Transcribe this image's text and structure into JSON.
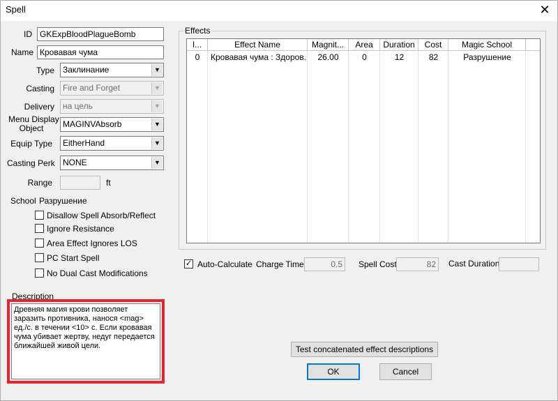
{
  "window": {
    "title": "Spell",
    "close_glyph": "✕"
  },
  "form": {
    "id_label": "ID",
    "id_value": "GKExpBloodPlagueBomb",
    "name_label": "Name",
    "name_value": "Кровавая чума",
    "type_label": "Type",
    "type_value": "Заклинание",
    "casting_label": "Casting",
    "casting_value": "Fire and Forget",
    "delivery_label": "Delivery",
    "delivery_value": "на цель",
    "menu_display_label_1": "Menu Display",
    "menu_display_label_2": "Object",
    "menu_display_value": "MAGINVAbsorb",
    "equip_type_label": "Equip Type",
    "equip_type_value": "EitherHand",
    "casting_perk_label": "Casting Perk",
    "casting_perk_value": "NONE",
    "range_label": "Range",
    "range_value": "",
    "range_unit": "ft",
    "school_label": "School",
    "school_value": "Разрушение"
  },
  "checkboxes": [
    {
      "label": "Disallow Spell Absorb/Reflect",
      "checked": false
    },
    {
      "label": "Ignore Resistance",
      "checked": false
    },
    {
      "label": "Area Effect Ignores LOS",
      "checked": false
    },
    {
      "label": "PC Start Spell",
      "checked": false
    },
    {
      "label": "No Dual Cast Modifications",
      "checked": false
    }
  ],
  "effects": {
    "group_label": "Effects",
    "columns": [
      "I...",
      "Effect Name",
      "Magnit...",
      "Area",
      "Duration",
      "Cost",
      "Magic School"
    ],
    "rows": [
      [
        "0",
        "Кровавая чума : Здоров...",
        "26.00",
        "0",
        "12",
        "82",
        "Разрушение"
      ]
    ]
  },
  "auto_calc": {
    "checkbox_label": "Auto-Calculate",
    "checked": true,
    "check_glyph": "✓",
    "charge_time_label": "Charge Time",
    "charge_time_value": "0.5",
    "spell_cost_label": "Spell Cost",
    "spell_cost_value": "82",
    "cast_duration_label": "Cast Duration",
    "cast_duration_value": ""
  },
  "description": {
    "label": "Description",
    "text": "Древняя магия крови позволяет заразить противника, нанося <mag> ед./с. в течении <10> с. Если кровавая чума убивает жертву, недуг передается ближайшей живой цели."
  },
  "buttons": {
    "test_desc": "Test concatenated effect descriptions",
    "ok": "OK",
    "cancel": "Cancel"
  },
  "icons": {
    "dropdown_arrow": "▼"
  },
  "colors": {
    "highlight_box": "#e0262f",
    "default_button_border": "#0078d7"
  }
}
